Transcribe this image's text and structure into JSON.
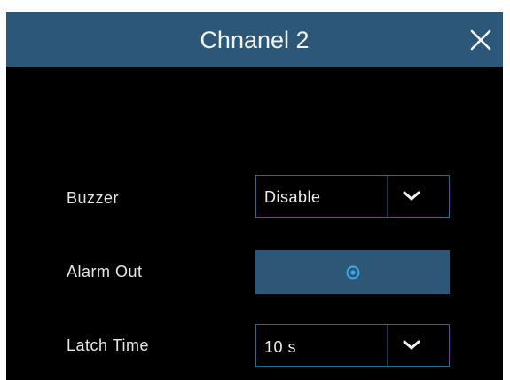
{
  "dialog": {
    "title": "Chnanel 2"
  },
  "fields": {
    "buzzer": {
      "label": "Buzzer",
      "value": "Disable"
    },
    "alarm_out": {
      "label": "Alarm Out"
    },
    "latch_time": {
      "label": "Latch Time",
      "value": "10 s"
    }
  },
  "icons": {
    "close": "close-icon",
    "chevron": "chevron-down-icon",
    "alarm_out": "target-icon"
  },
  "colors": {
    "titlebar": "#2d5778",
    "background": "#000000",
    "accent": "#36658c",
    "button": "#2e5777",
    "icon_accent": "#3aa8e8"
  }
}
